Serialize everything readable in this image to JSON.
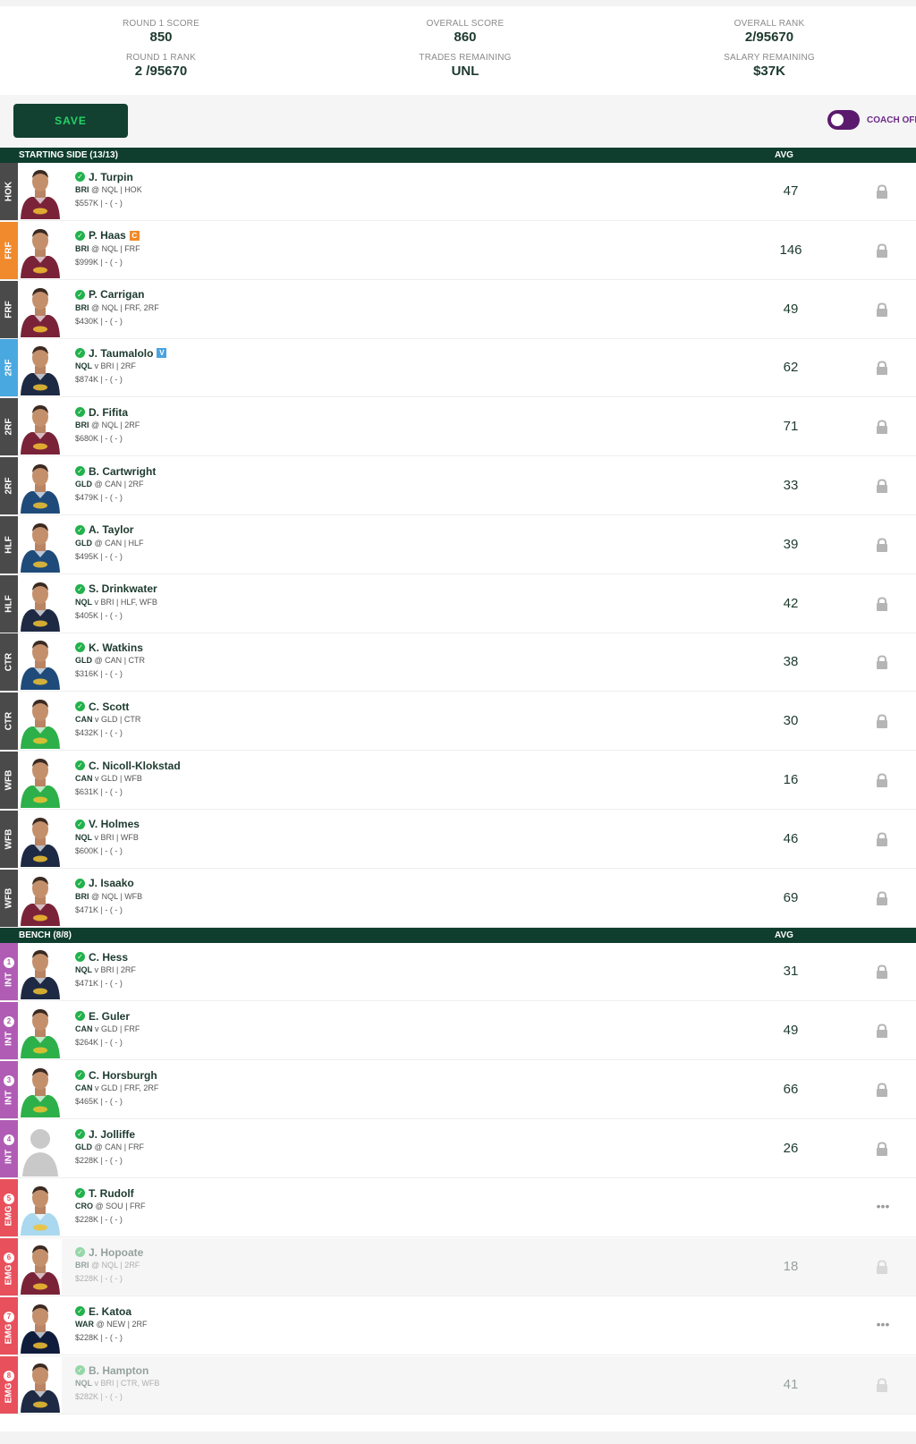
{
  "stats": {
    "round_score_label": "ROUND 1 SCORE",
    "round_score": "850",
    "round_rank_label": "ROUND 1 RANK",
    "round_rank": "2 /95670",
    "overall_score_label": "OVERALL SCORE",
    "overall_score": "860",
    "trades_label": "TRADES REMAINING",
    "trades": "UNL",
    "overall_rank_label": "OVERALL RANK",
    "overall_rank": "2/95670",
    "salary_label": "SALARY REMAINING",
    "salary": "$37K"
  },
  "toolbar": {
    "save_label": "SAVE",
    "coach_label": "COACH OFF"
  },
  "starting": {
    "title": "STARTING SIDE  (13/13)",
    "avg_label": "AVG"
  },
  "bench": {
    "title": "BENCH  (8/8)",
    "avg_label": "AVG"
  },
  "colors": {
    "tab_default": "#4a4a4a",
    "tab_captain": "#f08a2c",
    "tab_vice": "#4aa8e0",
    "tab_int": "#b05cb5",
    "tab_emg": "#e8505b",
    "brisbane": "#7a2338",
    "cowboys": "#1e2a44",
    "titans": "#1f4b7a",
    "raiders": "#2db04a",
    "sharks": "#a9d8ef",
    "warriors": "#101c3c",
    "unknown": "#cfcfcf"
  },
  "players": [
    {
      "pos": "HOK",
      "tab": "tab_default",
      "name": "J. Turpin",
      "team": "BRI",
      "sep": "@",
      "opp": "NQL",
      "positions": "HOK",
      "price": "$557K",
      "stat": "| - ( - )",
      "avg": "47",
      "action": "lock",
      "jersey": "brisbane",
      "dim": false,
      "badge": ""
    },
    {
      "pos": "FRF",
      "tab": "tab_captain",
      "name": "P. Haas",
      "team": "BRI",
      "sep": "@",
      "opp": "NQL",
      "positions": "FRF",
      "price": "$999K",
      "stat": "| - ( - )",
      "avg": "146",
      "action": "lock",
      "jersey": "brisbane",
      "dim": false,
      "badge": "C"
    },
    {
      "pos": "FRF",
      "tab": "tab_default",
      "name": "P. Carrigan",
      "team": "BRI",
      "sep": "@",
      "opp": "NQL",
      "positions": "FRF, 2RF",
      "price": "$430K",
      "stat": "| - ( - )",
      "avg": "49",
      "action": "lock",
      "jersey": "brisbane",
      "dim": false,
      "badge": ""
    },
    {
      "pos": "2RF",
      "tab": "tab_vice",
      "name": "J. Taumalolo",
      "team": "NQL",
      "sep": "v",
      "opp": "BRI",
      "positions": "2RF",
      "price": "$874K",
      "stat": "| - ( - )",
      "avg": "62",
      "action": "lock",
      "jersey": "cowboys",
      "dim": false,
      "badge": "V"
    },
    {
      "pos": "2RF",
      "tab": "tab_default",
      "name": "D. Fifita",
      "team": "BRI",
      "sep": "@",
      "opp": "NQL",
      "positions": "2RF",
      "price": "$680K",
      "stat": "| - ( - )",
      "avg": "71",
      "action": "lock",
      "jersey": "brisbane",
      "dim": false,
      "badge": ""
    },
    {
      "pos": "2RF",
      "tab": "tab_default",
      "name": "B. Cartwright",
      "team": "GLD",
      "sep": "@",
      "opp": "CAN",
      "positions": "2RF",
      "price": "$479K",
      "stat": "| - ( - )",
      "avg": "33",
      "action": "lock",
      "jersey": "titans",
      "dim": false,
      "badge": ""
    },
    {
      "pos": "HLF",
      "tab": "tab_default",
      "name": "A. Taylor",
      "team": "GLD",
      "sep": "@",
      "opp": "CAN",
      "positions": "HLF",
      "price": "$495K",
      "stat": "| - ( - )",
      "avg": "39",
      "action": "lock",
      "jersey": "titans",
      "dim": false,
      "badge": ""
    },
    {
      "pos": "HLF",
      "tab": "tab_default",
      "name": "S. Drinkwater",
      "team": "NQL",
      "sep": "v",
      "opp": "BRI",
      "positions": "HLF, WFB",
      "price": "$405K",
      "stat": "| - ( - )",
      "avg": "42",
      "action": "lock",
      "jersey": "cowboys",
      "dim": false,
      "badge": ""
    },
    {
      "pos": "CTR",
      "tab": "tab_default",
      "name": "K. Watkins",
      "team": "GLD",
      "sep": "@",
      "opp": "CAN",
      "positions": "CTR",
      "price": "$316K",
      "stat": "| - ( - )",
      "avg": "38",
      "action": "lock",
      "jersey": "titans",
      "dim": false,
      "badge": ""
    },
    {
      "pos": "CTR",
      "tab": "tab_default",
      "name": "C. Scott",
      "team": "CAN",
      "sep": "v",
      "opp": "GLD",
      "positions": "CTR",
      "price": "$432K",
      "stat": "| - ( - )",
      "avg": "30",
      "action": "lock",
      "jersey": "raiders",
      "dim": false,
      "badge": ""
    },
    {
      "pos": "WFB",
      "tab": "tab_default",
      "name": "C. Nicoll-Klokstad",
      "team": "CAN",
      "sep": "v",
      "opp": "GLD",
      "positions": "WFB",
      "price": "$631K",
      "stat": "| - ( - )",
      "avg": "16",
      "action": "lock",
      "jersey": "raiders",
      "dim": false,
      "badge": ""
    },
    {
      "pos": "WFB",
      "tab": "tab_default",
      "name": "V. Holmes",
      "team": "NQL",
      "sep": "v",
      "opp": "BRI",
      "positions": "WFB",
      "price": "$600K",
      "stat": "| - ( - )",
      "avg": "46",
      "action": "lock",
      "jersey": "cowboys",
      "dim": false,
      "badge": ""
    },
    {
      "pos": "WFB",
      "tab": "tab_default",
      "name": "J. Isaako",
      "team": "BRI",
      "sep": "@",
      "opp": "NQL",
      "positions": "WFB",
      "price": "$471K",
      "stat": "| - ( - )",
      "avg": "69",
      "action": "lock",
      "jersey": "brisbane",
      "dim": false,
      "badge": ""
    }
  ],
  "bench_players": [
    {
      "pos": "INT",
      "num": "1",
      "tab": "tab_int",
      "name": "C. Hess",
      "team": "NQL",
      "sep": "v",
      "opp": "BRI",
      "positions": "2RF",
      "price": "$471K",
      "stat": "| - ( - )",
      "avg": "31",
      "action": "lock",
      "jersey": "cowboys",
      "dim": false
    },
    {
      "pos": "INT",
      "num": "2",
      "tab": "tab_int",
      "name": "E. Guler",
      "team": "CAN",
      "sep": "v",
      "opp": "GLD",
      "positions": "FRF",
      "price": "$264K",
      "stat": "| - ( - )",
      "avg": "49",
      "action": "lock",
      "jersey": "raiders",
      "dim": false
    },
    {
      "pos": "INT",
      "num": "3",
      "tab": "tab_int",
      "name": "C. Horsburgh",
      "team": "CAN",
      "sep": "v",
      "opp": "GLD",
      "positions": "FRF, 2RF",
      "price": "$465K",
      "stat": "| - ( - )",
      "avg": "66",
      "action": "lock",
      "jersey": "raiders",
      "dim": false
    },
    {
      "pos": "INT",
      "num": "4",
      "tab": "tab_int",
      "name": "J. Jolliffe",
      "team": "GLD",
      "sep": "@",
      "opp": "CAN",
      "positions": "FRF",
      "price": "$228K",
      "stat": "| - ( - )",
      "avg": "26",
      "action": "lock",
      "jersey": "unknown",
      "dim": false
    },
    {
      "pos": "EMG",
      "num": "5",
      "tab": "tab_emg",
      "name": "T. Rudolf",
      "team": "CRO",
      "sep": "@",
      "opp": "SOU",
      "positions": "FRF",
      "price": "$228K",
      "stat": "| - ( - )",
      "avg": "",
      "action": "more",
      "jersey": "sharks",
      "dim": false
    },
    {
      "pos": "EMG",
      "num": "6",
      "tab": "tab_emg",
      "name": "J. Hopoate",
      "team": "BRI",
      "sep": "@",
      "opp": "NQL",
      "positions": "2RF",
      "price": "$228K",
      "stat": "| - ( - )",
      "avg": "18",
      "action": "lock",
      "jersey": "brisbane",
      "dim": true
    },
    {
      "pos": "EMG",
      "num": "7",
      "tab": "tab_emg",
      "name": "E. Katoa",
      "team": "WAR",
      "sep": "@",
      "opp": "NEW",
      "positions": "2RF",
      "price": "$228K",
      "stat": "| - ( - )",
      "avg": "",
      "action": "more",
      "jersey": "warriors",
      "dim": false
    },
    {
      "pos": "EMG",
      "num": "8",
      "tab": "tab_emg",
      "name": "B. Hampton",
      "team": "NQL",
      "sep": "v",
      "opp": "BRI",
      "positions": "CTR, WFB",
      "price": "$282K",
      "stat": "| - ( - )",
      "avg": "41",
      "action": "lock",
      "jersey": "cowboys",
      "dim": true
    }
  ]
}
